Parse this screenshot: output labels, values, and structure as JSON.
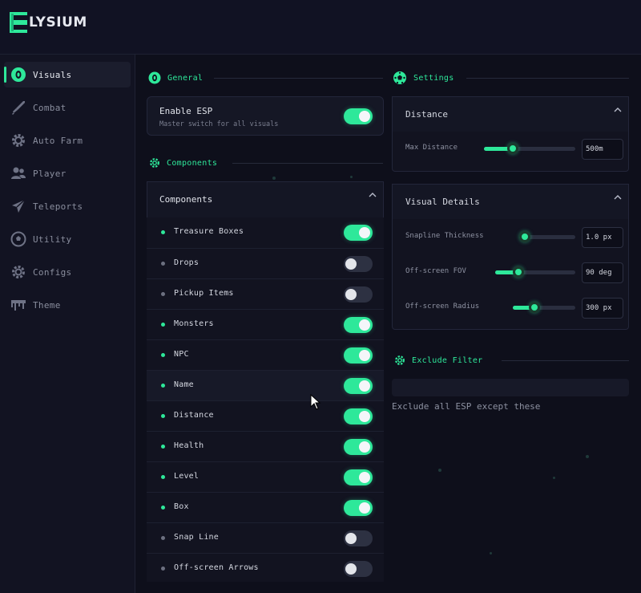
{
  "app": {
    "brand": "LYSIUM",
    "logo_letter": "E"
  },
  "sidebar": {
    "items": [
      {
        "label": "Visuals",
        "icon": "eye-icon",
        "active": true
      },
      {
        "label": "Combat",
        "icon": "sword-icon",
        "active": false
      },
      {
        "label": "Auto Farm",
        "icon": "gear-icon",
        "active": false
      },
      {
        "label": "Player",
        "icon": "users-icon",
        "active": false
      },
      {
        "label": "Teleports",
        "icon": "send-icon",
        "active": false
      },
      {
        "label": "Utility",
        "icon": "ball-icon",
        "active": false
      },
      {
        "label": "Configs",
        "icon": "cog-icon",
        "active": false
      },
      {
        "label": "Theme",
        "icon": "drip-icon",
        "active": false
      }
    ]
  },
  "general": {
    "title": "General",
    "enable_esp": {
      "label": "Enable ESP",
      "description": "Master switch for all visuals",
      "on": true
    }
  },
  "components_section": {
    "title": "Components"
  },
  "components": {
    "header": "Components",
    "items": [
      {
        "label": "Treasure Boxes",
        "on": true
      },
      {
        "label": "Drops",
        "on": false
      },
      {
        "label": "Pickup Items",
        "on": false
      },
      {
        "label": "Monsters",
        "on": true
      },
      {
        "label": "NPC",
        "on": true
      },
      {
        "label": "Name",
        "on": true
      },
      {
        "label": "Distance",
        "on": true
      },
      {
        "label": "Health",
        "on": true
      },
      {
        "label": "Level",
        "on": true
      },
      {
        "label": "Box",
        "on": true
      },
      {
        "label": "Snap Line",
        "on": false
      },
      {
        "label": "Off-screen Arrows",
        "on": false
      }
    ]
  },
  "settings": {
    "title": "Settings",
    "distance": {
      "header": "Distance",
      "max_distance": {
        "label": "Max Distance",
        "value": "500m",
        "fraction": 0.25
      }
    },
    "visual_details": {
      "header": "Visual Details",
      "snapline_thickness": {
        "label": "Snapline Thickness",
        "value": "1.0 px",
        "fraction": 0.0
      },
      "offscreen_fov": {
        "label": "Off-screen FOV",
        "value": "90 deg",
        "fraction": 0.22
      },
      "offscreen_radius": {
        "label": "Off-screen Radius",
        "value": "300 px",
        "fraction": 0.25
      }
    }
  },
  "exclude_filter": {
    "title": "Exclude Filter",
    "hint": "Exclude all ESP except these",
    "value": ""
  },
  "colors": {
    "accent": "#2ee89a",
    "background": "#0e0f1b",
    "panel": "#151725"
  }
}
